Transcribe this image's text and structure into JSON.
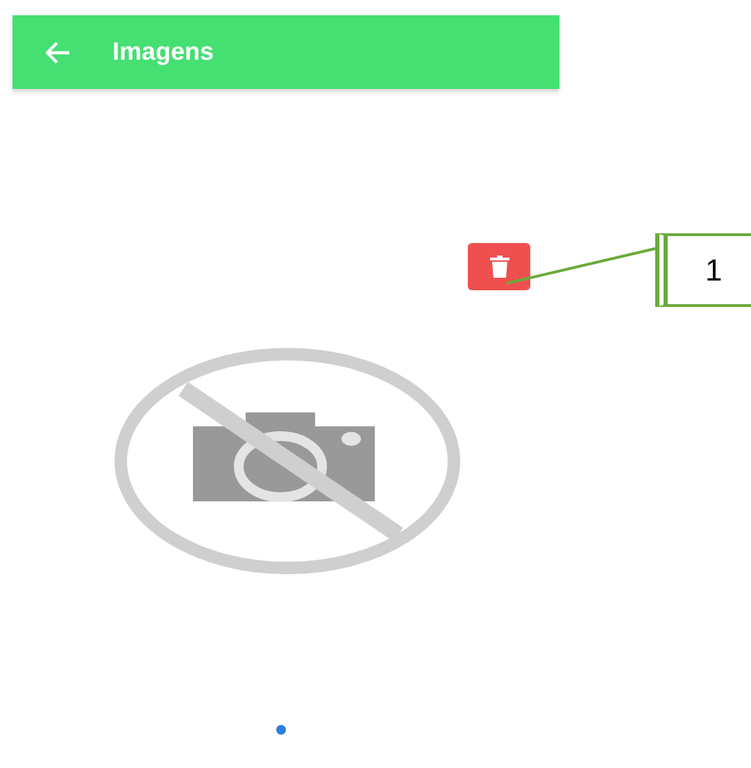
{
  "app_bar": {
    "title": "Imagens"
  },
  "delete_button": {
    "kind": "trash"
  },
  "image": {
    "kind": "picture-missing"
  },
  "pager": [
    {
      "selected": true
    }
  ],
  "callout": {
    "label": "1"
  }
}
